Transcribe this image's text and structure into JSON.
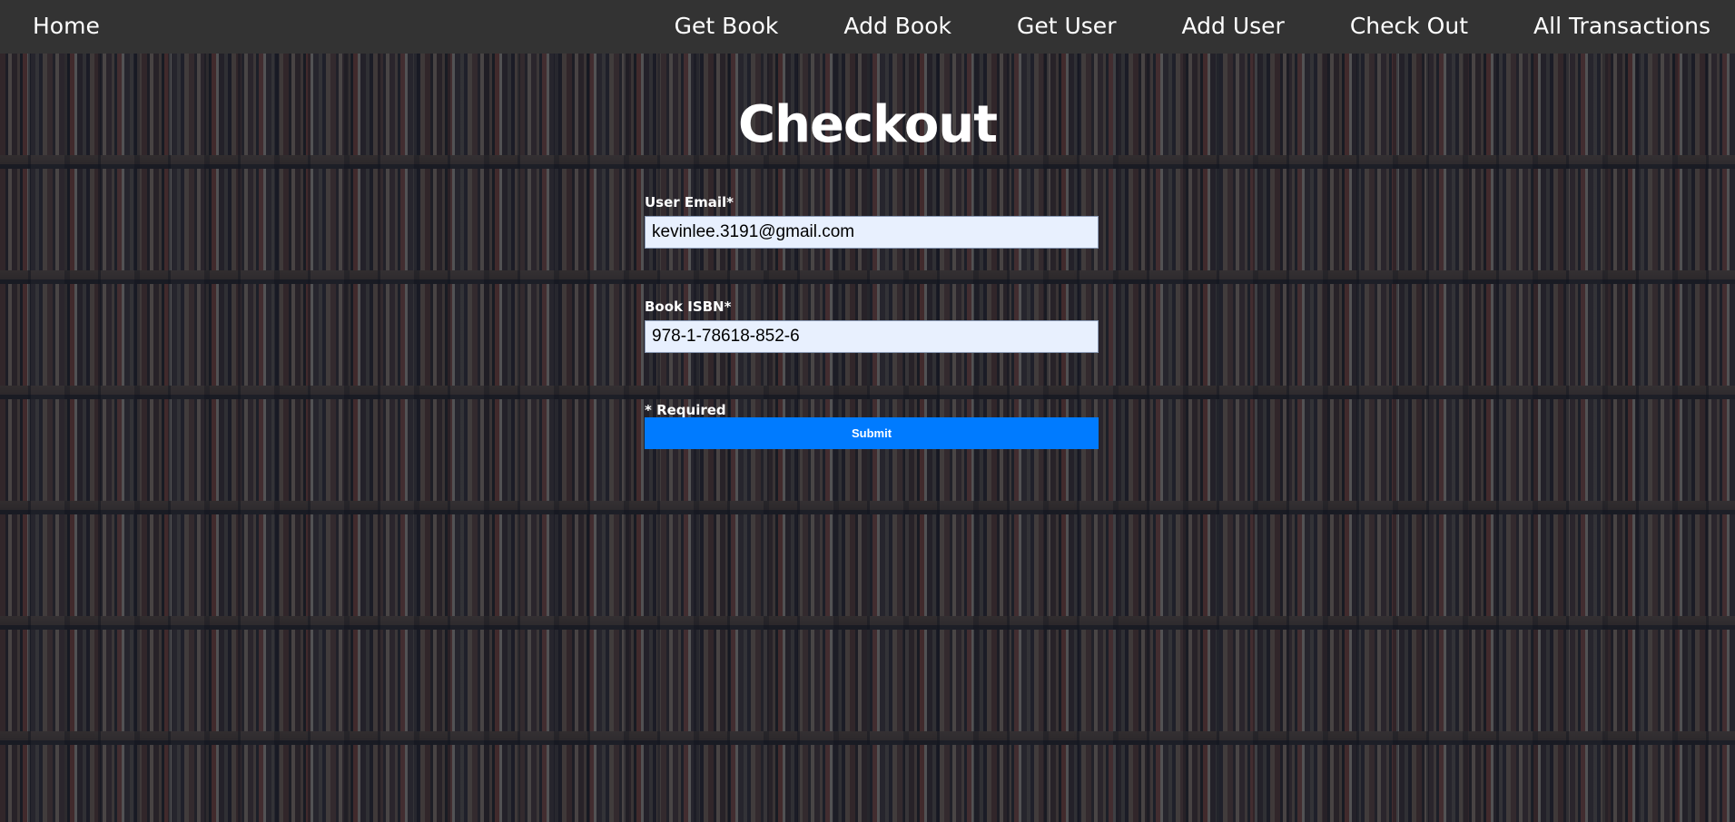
{
  "navbar": {
    "home": "Home",
    "links": [
      "Get Book",
      "Add Book",
      "Get User",
      "Add User",
      "Check Out",
      "All Transactions"
    ]
  },
  "page": {
    "title": "Checkout"
  },
  "form": {
    "email_label": "User Email*",
    "email_value": "kevinlee.3191@gmail.com",
    "isbn_label": "Book ISBN*",
    "isbn_value": "978-1-78618-852-6",
    "required_note": "* Required",
    "submit_label": "Submit"
  },
  "colors": {
    "navbar_bg": "#333333",
    "submit_bg": "#007bff",
    "input_bg": "#e8f0fe",
    "text": "#ffffff"
  }
}
